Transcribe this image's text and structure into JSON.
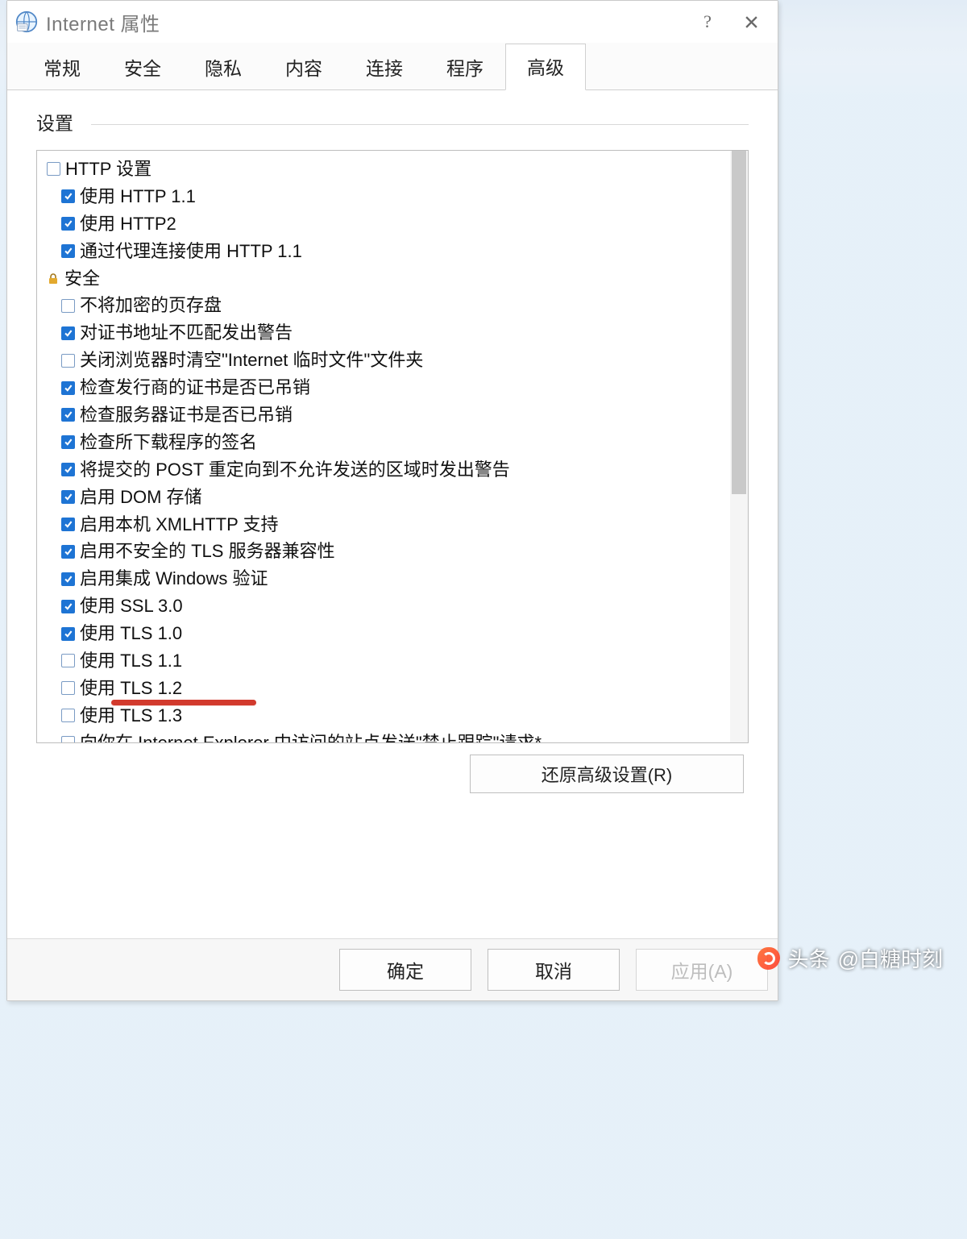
{
  "window": {
    "title": "Internet 属性",
    "help": "?",
    "close": "×"
  },
  "tabs": {
    "items": [
      {
        "label": "常规"
      },
      {
        "label": "安全"
      },
      {
        "label": "隐私"
      },
      {
        "label": "内容"
      },
      {
        "label": "连接"
      },
      {
        "label": "程序"
      },
      {
        "label": "高级"
      }
    ],
    "active_index": 6
  },
  "group": {
    "label": "设置"
  },
  "tree": [
    {
      "type": "section",
      "glyph": "box",
      "label": "HTTP 设置"
    },
    {
      "type": "child",
      "checked": true,
      "label": "使用 HTTP 1.1"
    },
    {
      "type": "child",
      "checked": true,
      "label": "使用 HTTP2"
    },
    {
      "type": "child",
      "checked": true,
      "label": "通过代理连接使用 HTTP 1.1"
    },
    {
      "type": "section",
      "glyph": "lock",
      "label": "安全"
    },
    {
      "type": "child",
      "checked": false,
      "label": "不将加密的页存盘"
    },
    {
      "type": "child",
      "checked": true,
      "label": "对证书地址不匹配发出警告"
    },
    {
      "type": "child",
      "checked": false,
      "label": "关闭浏览器时清空\"Internet 临时文件\"文件夹"
    },
    {
      "type": "child",
      "checked": true,
      "label": "检查发行商的证书是否已吊销"
    },
    {
      "type": "child",
      "checked": true,
      "label": "检查服务器证书是否已吊销"
    },
    {
      "type": "child",
      "checked": true,
      "label": "检查所下载程序的签名"
    },
    {
      "type": "child",
      "checked": true,
      "label": "将提交的 POST 重定向到不允许发送的区域时发出警告"
    },
    {
      "type": "child",
      "checked": true,
      "label": "启用 DOM 存储"
    },
    {
      "type": "child",
      "checked": true,
      "label": "启用本机 XMLHTTP 支持"
    },
    {
      "type": "child",
      "checked": true,
      "label": "启用不安全的 TLS 服务器兼容性"
    },
    {
      "type": "child",
      "checked": true,
      "label": "启用集成 Windows 验证"
    },
    {
      "type": "child",
      "checked": true,
      "label": "使用 SSL 3.0"
    },
    {
      "type": "child",
      "checked": true,
      "label": "使用 TLS 1.0"
    },
    {
      "type": "child",
      "checked": false,
      "label": "使用 TLS 1.1"
    },
    {
      "type": "child",
      "checked": false,
      "label": "使用 TLS 1.2",
      "underline": true
    },
    {
      "type": "child",
      "checked": false,
      "label": "使用 TLS 1.3"
    },
    {
      "type": "child",
      "checked": false,
      "label": "向你在 Internet Explorer 中访问的站点发送\"禁止跟踪\"请求*"
    }
  ],
  "restore_button": "还原高级设置(R)",
  "footer": {
    "ok": "确定",
    "cancel": "取消",
    "apply": "应用(A)"
  },
  "watermark": {
    "prefix": "头条",
    "handle": "@白糖时刻"
  }
}
